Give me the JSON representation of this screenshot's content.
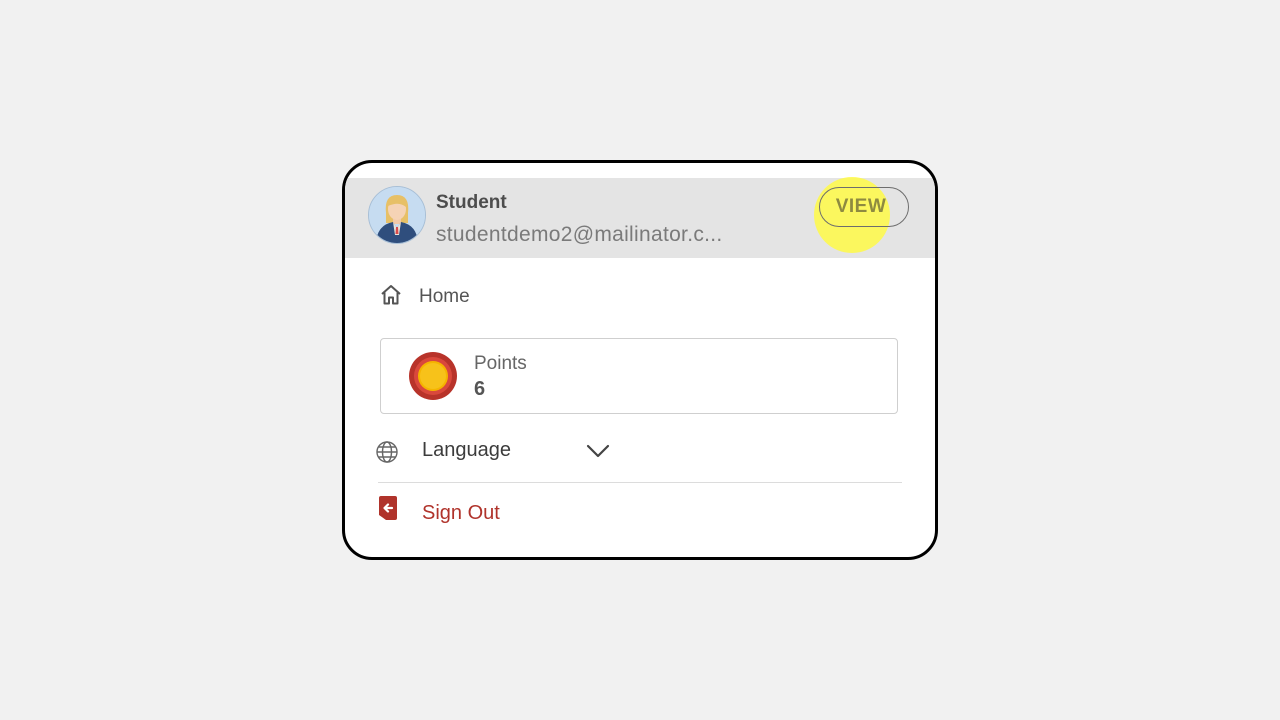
{
  "profile": {
    "name": "Student",
    "email": "studentdemo2@mailinator.c...",
    "view_label": "VIEW",
    "avatar_icon": "user-avatar-icon"
  },
  "menu": {
    "home": {
      "label": "Home",
      "icon": "home-icon"
    },
    "points": {
      "label": "Points",
      "value": "6",
      "icon": "coin-icon"
    },
    "language": {
      "label": "Language",
      "icon": "globe-icon",
      "chevron_icon": "chevron-down-icon"
    },
    "sign_out": {
      "label": "Sign Out",
      "icon": "sign-out-icon"
    }
  },
  "colors": {
    "header_bg": "#e4e4e4",
    "highlight": "#fffa46",
    "sign_out": "#b0332b",
    "coin_outer": "#c0392b",
    "coin_inner": "#f5b400"
  }
}
